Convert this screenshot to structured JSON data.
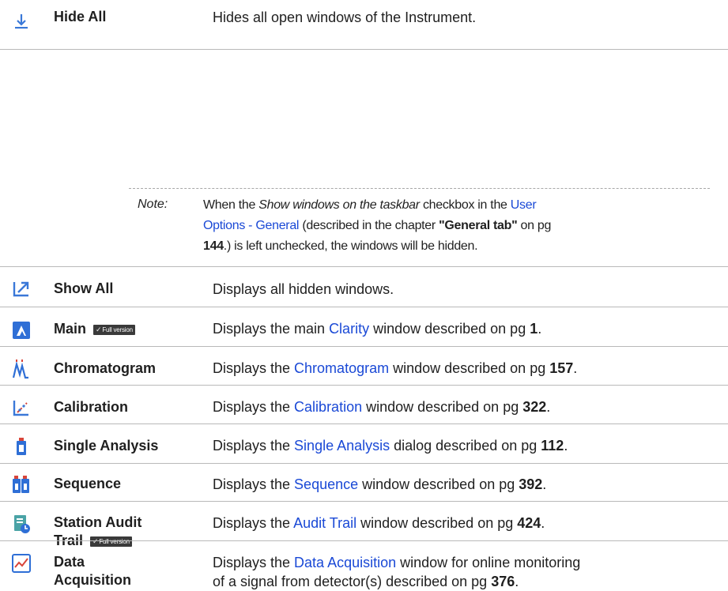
{
  "rows": [
    {
      "icon": "hide-all-icon",
      "name": "Hide All",
      "desc": "Hides all open windows of the Instrument."
    },
    {
      "icon": "show-all-icon",
      "name": "Show All",
      "desc": "Displays all hidden windows."
    },
    {
      "icon": "main-icon",
      "name": "Main",
      "badge": "Full version",
      "desc_pre": "Displays the main ",
      "link": "Clarity",
      "desc_post": " window described on pg ",
      "page": "1",
      "end": "."
    },
    {
      "icon": "chromatogram-icon",
      "name": "Chromatogram",
      "desc_pre": "Displays the ",
      "link": "Chromatogram",
      "desc_post": " window described on pg ",
      "page": "157",
      "end": "."
    },
    {
      "icon": "calibration-icon",
      "name": "Calibration",
      "desc_pre": "Displays the ",
      "link": "Calibration",
      "desc_post": " window described on pg ",
      "page": "322",
      "end": "."
    },
    {
      "icon": "single-analysis-icon",
      "name": "Single Analysis",
      "desc_pre": "Displays the ",
      "link": "Single Analysis",
      "desc_post": " dialog described on pg ",
      "page": "112",
      "end": "."
    },
    {
      "icon": "sequence-icon",
      "name": "Sequence",
      "desc_pre": "Displays the ",
      "link": "Sequence",
      "desc_post": " window described on pg ",
      "page": "392",
      "end": "."
    },
    {
      "icon": "station-audit-trail-icon",
      "name_line1": "Station Audit",
      "name_line2": "Trail",
      "badge": "Full version",
      "desc_pre": "Displays the ",
      "link": "Audit Trail",
      "desc_post": " window described on pg ",
      "page": "424",
      "end": "."
    },
    {
      "icon": "data-acquisition-icon",
      "name_line1": "Data",
      "name_line2": "Acquisition",
      "desc_pre": "Displays the ",
      "link": "Data Acquisition",
      "desc_post": " window for online monitoring",
      "desc_line2": "of a signal from detector(s) described on pg ",
      "page": "376",
      "end": "."
    }
  ],
  "note": {
    "label": "Note:",
    "t1": "When the ",
    "i1": "Show windows on the taskbar",
    "t2": " checkbox in the ",
    "link1": "User",
    "link2": "Options - General",
    "t3": " (described in the chapter ",
    "b1": "\"General tab\"",
    "t4": " on pg",
    "b2": "144",
    "t5": ".) is left unchecked, the windows will be hidden."
  }
}
